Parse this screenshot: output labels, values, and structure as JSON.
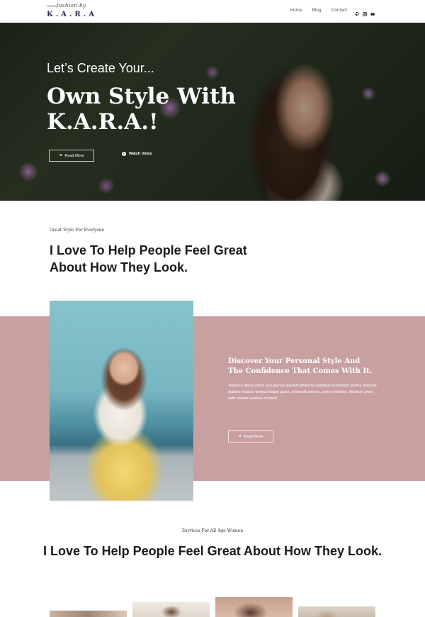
{
  "header": {
    "logo_script": "fashion by",
    "logo_brand": "K.A.R.A",
    "nav": [
      "Home",
      "Blog",
      "Contact"
    ],
    "social_icons": [
      "pinterest-icon",
      "instagram-icon",
      "youtube-icon"
    ]
  },
  "hero": {
    "subtitle": "Let’s Create Your...",
    "title": "Own Style With K.A.R.A.!",
    "read_more": "Read More",
    "watch_video": "Watch Video"
  },
  "intro": {
    "eyebrow": "Great Style For Everyone",
    "heading": "I Love To Help People Feel Great About How They Look."
  },
  "feature": {
    "heading": "Discover Your Personal Style And The Confidence That Comes With It.",
    "text": "Tempora aliqua cillum accusamus aperiam pharetra cupidatat fermentum viverra delectus quidem incidunt tempus itaque quam, id blandit dolores, proin reiciendis. Nostrum proin sem veniam veritatis incidunt!",
    "read_more": "Read More"
  },
  "services": {
    "eyebrow": "Services For All Age Women",
    "heading": "I Love To Help People Feel Great About How They Look."
  },
  "colors": {
    "accent_pink": "#c9a0a0",
    "brand_navy": "#2c2d4a"
  }
}
